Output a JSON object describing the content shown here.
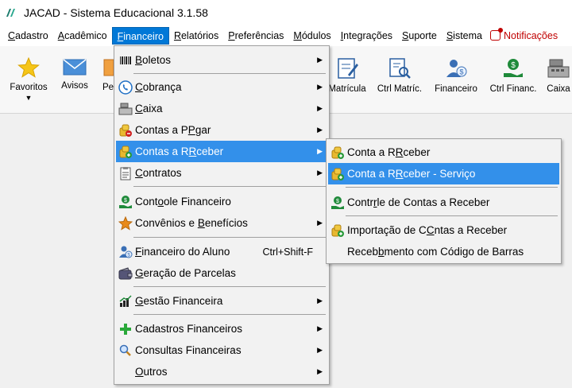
{
  "app": {
    "title": "JACAD - Sistema Educacional 3.1.58",
    "logo_icon": "jacad-logo-icon"
  },
  "menubar": {
    "items": [
      {
        "label": "Cadastro"
      },
      {
        "label": "Acadêmico"
      },
      {
        "label": "Financeiro",
        "active": true
      },
      {
        "label": "Relatórios"
      },
      {
        "label": "Preferências"
      },
      {
        "label": "Módulos"
      },
      {
        "label": "Integrações"
      },
      {
        "label": "Suporte"
      },
      {
        "label": "Sistema"
      }
    ],
    "notifications": {
      "label": "Notificações",
      "color": "#c00000"
    }
  },
  "toolbar": {
    "favoritos": "Favoritos",
    "avisos": "Avisos",
    "pe_partial": "Pe",
    "matricula": "Matrícula",
    "ctrl_matric": "Ctrl Matríc.",
    "financeiro": "Financeiro",
    "ctrl_financ": "Ctrl Financ.",
    "caixa": "Caixa"
  },
  "financeiro_menu": {
    "items": [
      {
        "label": "Boletos",
        "icon": "barcode-icon",
        "submenu": true
      },
      {
        "label": "Cobrança",
        "icon": "phone-icon",
        "submenu": true
      },
      {
        "label": "Caixa",
        "icon": "cash-register-icon",
        "submenu": true
      },
      {
        "label": "Contas a Pagar",
        "icon": "coins-minus-icon",
        "submenu": true
      },
      {
        "label": "Contas a Receber",
        "icon": "coins-plus-icon",
        "submenu": true,
        "highlighted": true
      },
      {
        "label": "Contratos",
        "icon": "clipboard-icon",
        "submenu": true
      },
      {
        "label": "Controle Financeiro",
        "icon": "money-hand-icon",
        "submenu": false
      },
      {
        "label": "Convênios e Benefícios",
        "icon": "star-icon",
        "submenu": true
      },
      {
        "label": "Financeiro do Aluno",
        "icon": "student-money-icon",
        "shortcut": "Ctrl+Shift-F"
      },
      {
        "label": "Geração de Parcelas",
        "icon": "wallet-icon"
      },
      {
        "label": "Gestão Financeira",
        "icon": "bar-chart-icon",
        "submenu": true
      },
      {
        "label": "Cadastros Financeiros",
        "icon": "plus-icon",
        "submenu": true
      },
      {
        "label": "Consultas Financeiras",
        "icon": "magnifier-icon",
        "submenu": true
      },
      {
        "label": "Outros",
        "icon": "",
        "submenu": true
      }
    ]
  },
  "receber_submenu": {
    "items": [
      {
        "label": "Conta a Receber",
        "icon": "coins-plus-icon"
      },
      {
        "label": "Conta a Receber - Serviço",
        "icon": "coins-plus-icon",
        "highlighted": true
      },
      {
        "label": "Controle de Contas a Receber",
        "icon": "money-hand-icon"
      },
      {
        "label": "Importação de Contas a Receber",
        "icon": "coins-plus-icon"
      },
      {
        "label": "Recebimento com Código de Barras",
        "icon": ""
      }
    ]
  },
  "colors": {
    "highlight": "#3390ea",
    "menubar_active": "#0078d7",
    "notification": "#c00000"
  }
}
